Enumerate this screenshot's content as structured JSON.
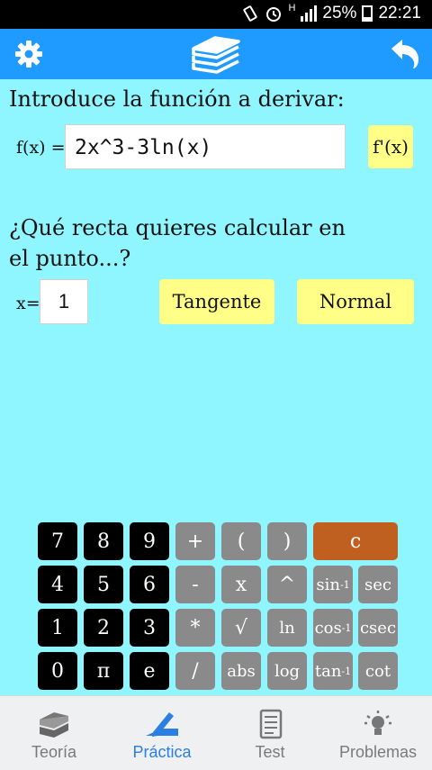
{
  "status_bar": {
    "network_type": "H",
    "battery": "25%",
    "time": "22:21"
  },
  "app": {
    "prompt": "Introduce la función a derivar:"
  },
  "function_input": {
    "label": "f(x) =",
    "value": "2x^3-3ln(x)"
  },
  "derive_button": {
    "label": "f'(x)"
  },
  "question": {
    "text": "¿Qué recta quieres calcular en el punto...?"
  },
  "point_input": {
    "label": "x=",
    "value": "1"
  },
  "actions": {
    "tangent_label": "Tangente",
    "normal_label": "Normal"
  },
  "keypad": {
    "rows": [
      [
        "7",
        "8",
        "9",
        "+",
        "(",
        ")",
        "c"
      ],
      [
        "4",
        "5",
        "6",
        "-",
        "x",
        "^",
        "sin-1",
        "sec"
      ],
      [
        "1",
        "2",
        "3",
        "*",
        "√",
        "ln",
        "cos-1",
        "csec"
      ],
      [
        "0",
        "π",
        "e",
        "/",
        "abs",
        "log",
        "tan-1",
        "cot"
      ]
    ],
    "keys": {
      "k7": "7",
      "k8": "8",
      "k9": "9",
      "plus": "+",
      "lparen": "(",
      "rparen": ")",
      "clear": "c",
      "k4": "4",
      "k5": "5",
      "k6": "6",
      "minus": "-",
      "x": "x",
      "pow": "^",
      "asin": "sin",
      "asin_sup": "-1",
      "sec": "sec",
      "k1": "1",
      "k2": "2",
      "k3": "3",
      "mul": "*",
      "sqrt": "√",
      "ln": "ln",
      "acos": "cos",
      "acos_sup": "-1",
      "csec": "csec",
      "k0": "0",
      "pi": "π",
      "e": "e",
      "div": "/",
      "abs": "abs",
      "log": "log",
      "atan": "tan",
      "atan_sup": "-1",
      "cot": "cot"
    }
  },
  "bottom_nav": {
    "items": [
      {
        "label": "Teoría",
        "icon": "books-icon"
      },
      {
        "label": "Práctica",
        "icon": "pencil-ruler-icon",
        "active": true
      },
      {
        "label": "Test",
        "icon": "checklist-icon"
      },
      {
        "label": "Problemas",
        "icon": "lightbulb-icon"
      }
    ]
  },
  "colors": {
    "background": "#8ff5ff",
    "appbar": "#1f9bff",
    "button_yellow": "#ffff88",
    "clear_key": "#c06020",
    "active_nav": "#2a7fe0"
  }
}
